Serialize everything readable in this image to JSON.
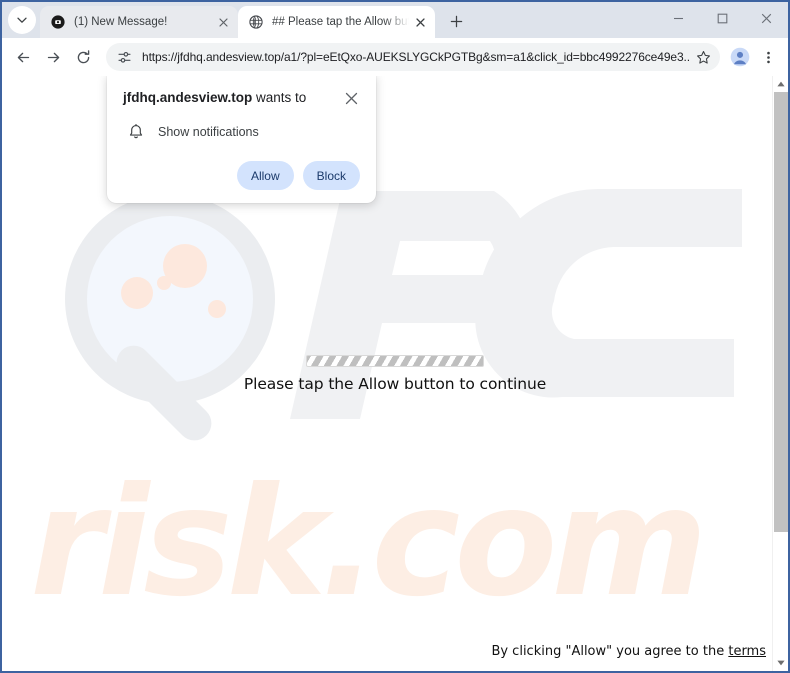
{
  "window": {
    "controls": {
      "minimize": "minimize-button",
      "maximize": "maximize-button",
      "close": "close-button"
    }
  },
  "tabs": {
    "search_tab_icon": "chevron-down-icon",
    "new_tab_label": "+",
    "items": [
      {
        "title": "(1) New Message!",
        "favicon": "dark-circle-favicon",
        "active": false,
        "close_label": "×"
      },
      {
        "title": "## Please tap the Allow button",
        "favicon": "globe-favicon",
        "active": true,
        "close_label": "×"
      }
    ]
  },
  "toolbar": {
    "back_label": "Back",
    "forward_label": "Forward",
    "reload_label": "Reload",
    "site_info_label": "View site information",
    "url": "https://jfdhq.andesview.top/a1/?pl=eEtQxo-AUEKSLYGCkPGTBg&sm=a1&click_id=bbc4992276ce49e3...",
    "bookmark_label": "Bookmark this tab",
    "profile_label": "Profile",
    "menu_label": "Customize and control Google Chrome"
  },
  "permission_dialog": {
    "origin": "jfdhq.andesview.top",
    "title_suffix": " wants to",
    "close_label": "×",
    "permission_icon": "bell-icon",
    "permission_label": "Show notifications",
    "allow_label": "Allow",
    "block_label": "Block",
    "button_bg": "#d3e3fd",
    "button_text_color": "#1b3a6b"
  },
  "page": {
    "progress_label": "loading-progress",
    "heading": "Please tap the Allow button to continue",
    "footer_prefix": "By clicking \"Allow\" you agree to the ",
    "footer_link": "terms",
    "watermark_primary": "PC",
    "watermark_secondary": "risk.com"
  },
  "scrollbar": {
    "up_arrow": "▲",
    "down_arrow": "▼"
  },
  "colors": {
    "frame": "#3d63a0",
    "tabstrip": "#dee3eb",
    "omnibox": "#f1f3f4",
    "accent_blue": "#d3e3fd"
  }
}
